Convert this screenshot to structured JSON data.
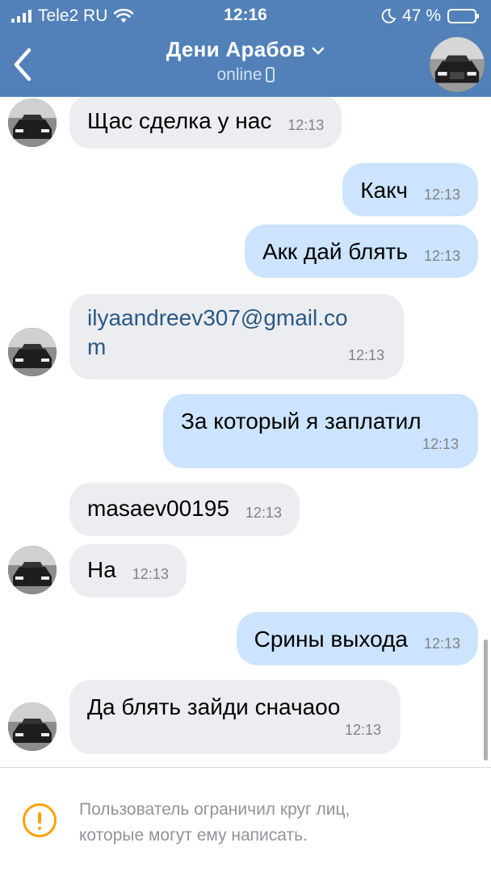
{
  "status_bar": {
    "carrier": "Tele2 RU",
    "time": "12:16",
    "battery": "47 %",
    "battery_level": 0.47
  },
  "header": {
    "contact_name": "Дени Арабов",
    "status": "online"
  },
  "messages": [
    {
      "dir": "in",
      "text": "Щас сделка у нас",
      "time": "12:13"
    },
    {
      "dir": "out",
      "text": "Какч",
      "time": "12:13"
    },
    {
      "dir": "out",
      "text": "Акк дай блять",
      "time": "12:13"
    },
    {
      "dir": "in",
      "text_line1": "ilyaandreev307@gmail.co",
      "text_line2": "m",
      "time": "12:13",
      "is_link": true
    },
    {
      "dir": "out",
      "text": "За который я заплатил",
      "time": "12:13"
    },
    {
      "dir": "in",
      "text": "masaev00195",
      "time": "12:13"
    },
    {
      "dir": "in",
      "text": "На",
      "time": "12:13"
    },
    {
      "dir": "out",
      "text": "Срины выхода",
      "time": "12:13"
    },
    {
      "dir": "in",
      "text": "Да блять зайди сначаоо",
      "time": "12:13"
    }
  ],
  "footer": {
    "notice_line1": "Пользователь ограничил круг лиц,",
    "notice_line2": "которые могут ему написать."
  },
  "colors": {
    "header_bg": "#5181b8",
    "incoming_bubble": "#ebedf0",
    "outgoing_bubble": "#cce4ff",
    "link": "#2a5885",
    "warning": "#ffa000"
  }
}
